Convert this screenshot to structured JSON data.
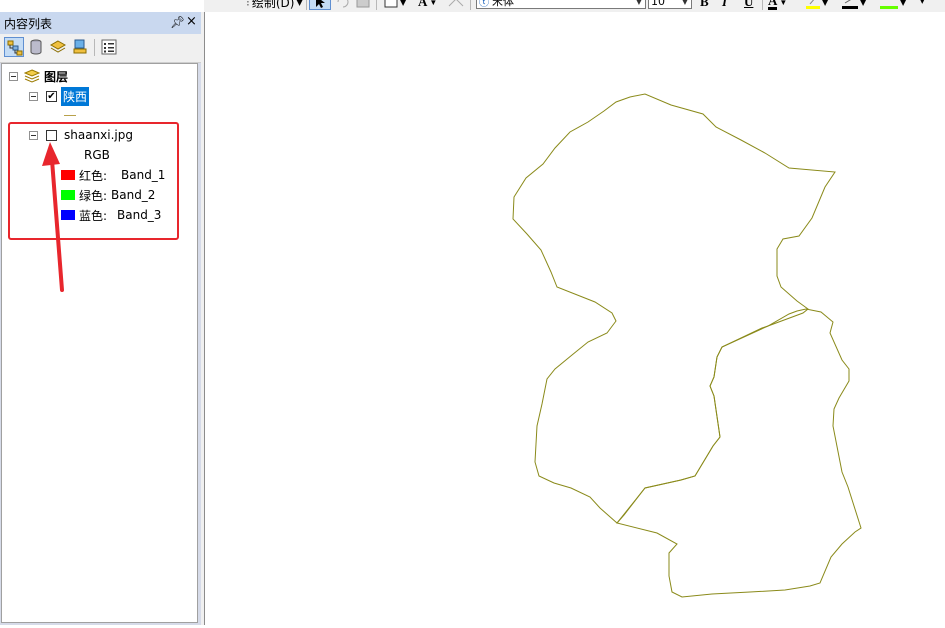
{
  "toolbar": {
    "draw_label": "绘制(D)",
    "font_name": "宋体",
    "font_size": "10",
    "bold": "B",
    "italic": "I",
    "underline": "U",
    "font_color_glyph": "A",
    "text_tool_glyph": "A",
    "icons": [
      "pointer-icon",
      "rotate-icon",
      "image-icon",
      "rectangle-icon",
      "text-icon",
      "line-style-icon"
    ],
    "colors": {
      "font": "#000000",
      "highlight": "#ffff00",
      "line": "#000000",
      "fill": "#66ff00"
    }
  },
  "toc": {
    "title": "内容列表",
    "pin_glyph": "ꟼ",
    "close_glyph": "×",
    "tools": [
      "list-by-drawing-order-icon",
      "list-by-source-icon",
      "list-by-visibility-icon",
      "list-by-selection-icon",
      "options-icon"
    ],
    "tree": {
      "root_label": "图层",
      "layers": [
        {
          "name": "陕西",
          "checked": true,
          "selected": true,
          "symbol_color": "#b8a14a"
        },
        {
          "name": "shaanxi.jpg",
          "checked": false,
          "selected": false,
          "renderer": "RGB",
          "bands": [
            {
              "channel": "红色:",
              "band": "Band_1",
              "color": "#ff0000"
            },
            {
              "channel": "绿色:",
              "band": "Band_2",
              "color": "#00ff00"
            },
            {
              "channel": "蓝色:",
              "band": "Band_3",
              "color": "#0000ff"
            }
          ]
        }
      ]
    }
  },
  "annotation_color": "#e8262d",
  "map": {
    "outline_color": "#8a8a1a"
  }
}
